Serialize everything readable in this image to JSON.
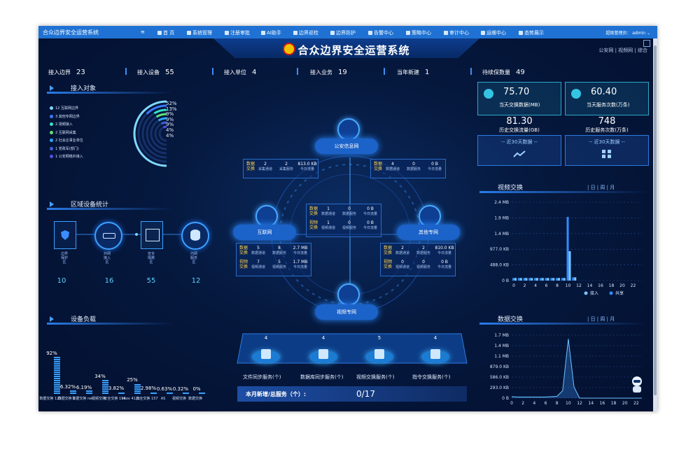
{
  "nav": {
    "brand": "合众边界安全运营系统",
    "items": [
      "首 页",
      "系统管理",
      "注册审批",
      "AI助手",
      "边界巡检",
      "边界防护",
      "告警中心",
      "策略中心",
      "审计中心",
      "运维中心",
      "态势展示"
    ],
    "user": "超级管理员： admin"
  },
  "dash": {
    "title": "合众边界安全运营系统",
    "topright": "公安网 | 视频网 | 综合",
    "stats": [
      {
        "label": "接入边界",
        "value": "23"
      },
      {
        "label": "接入设备",
        "value": "55"
      },
      {
        "label": "接入单位",
        "value": "4"
      },
      {
        "label": "接入业务",
        "value": "19"
      },
      {
        "label": "当年新建",
        "value": "1"
      },
      {
        "label": "待续保数量",
        "value": "49"
      }
    ]
  },
  "access": {
    "heading": "接入对象",
    "legend": [
      {
        "text": "12 互联网边界",
        "color": "#7fd8ff"
      },
      {
        "text": "3 其他专网边界",
        "color": "#3b78ff"
      },
      {
        "text": "2 视频接入",
        "color": "#36e0c8"
      },
      {
        "text": "2 互联网采集",
        "color": "#5fe07a"
      },
      {
        "text": "2 社会企事业单位",
        "color": "#2aa6ff"
      },
      {
        "text": "1 党政军(部门)",
        "color": "#3b62d8"
      },
      {
        "text": "1 公安网络外接入",
        "color": "#5a4fe0"
      }
    ],
    "percents": [
      "52%",
      "13%",
      "9%",
      "9%",
      "9%",
      "4%",
      "4%"
    ],
    "chart_data": {
      "type": "radial-bar",
      "categories": [
        "12 互联网边界",
        "3 其他专网边界",
        "2 视频接入",
        "2 互联网采集",
        "2 社会企事业单位",
        "1 党政军(部门)",
        "1 公安网络外接入"
      ],
      "values": [
        52,
        13,
        9,
        9,
        9,
        4,
        4
      ]
    }
  },
  "region": {
    "heading": "区域设备统计",
    "items": [
      {
        "label": "边界保护区",
        "value": "10"
      },
      {
        "label": "外网接入区",
        "value": "16"
      },
      {
        "label": "安全隔离区",
        "value": "55"
      },
      {
        "label": "内网服务区",
        "value": "12"
      }
    ]
  },
  "load": {
    "heading": "设备负载",
    "chart_data": {
      "type": "bar",
      "categories": [
        "数据交换",
        "数据交换\n123",
        "数据交换\n1",
        "视频交换\nnei",
        "视频交换",
        "安全交换\n156",
        "vaov\n4121",
        "安全交换\n157",
        "AS",
        "视频交换\n视频交换"
      ],
      "values": [
        92,
        6.32,
        6.19,
        34,
        3.82,
        25,
        2.98,
        0.63,
        0.32,
        0
      ],
      "labels": [
        "92%",
        "6.32%",
        "6.19%",
        "34%",
        "3.82%",
        "25%",
        "2.98%",
        "0.63%",
        "0.32%",
        "0%"
      ]
    },
    "xlabels": [
      "数据交换\n123",
      "数据交换\n1",
      "数据交换\nnei",
      "视频交换",
      "安全交换\n156",
      "vaov\n4121",
      "安全交换\n157",
      "AS",
      "视频交换",
      "数据交换"
    ]
  },
  "center": {
    "nodes": {
      "top": "公安信息网",
      "left": "互联网",
      "right": "其他专网",
      "bottom": "视频专网"
    },
    "cards": {
      "topleft": {
        "label": "数据交换",
        "cells": [
          {
            "n": "2",
            "d": "采集通道"
          },
          {
            "n": "2",
            "d": "采集服务"
          },
          {
            "n": "813.0 KB",
            "d": "今日流量"
          }
        ]
      },
      "topright": {
        "label": "数据交换",
        "cells": [
          {
            "n": "4",
            "d": "数据通道"
          },
          {
            "n": "0",
            "d": "数据服务"
          },
          {
            "n": "0 B",
            "d": "今日流量"
          }
        ]
      },
      "middle": [
        {
          "label": "数据交换",
          "cells": [
            {
              "n": "1",
              "d": "数据通道"
            },
            {
              "n": "0",
              "d": "数据服务"
            },
            {
              "n": "0 B",
              "d": "今日流量"
            }
          ]
        },
        {
          "label": "视频交换",
          "cells": [
            {
              "n": "1",
              "d": "视频通道"
            },
            {
              "n": "0",
              "d": "视频服务"
            },
            {
              "n": "0 B",
              "d": "今日流量"
            }
          ]
        }
      ],
      "left": [
        {
          "label": "数据交换",
          "cells": [
            {
              "n": "5",
              "d": "数据通道"
            },
            {
              "n": "8",
              "d": "数据服务"
            },
            {
              "n": "2.7 MB",
              "d": "今日流量"
            }
          ]
        },
        {
          "label": "视频交换",
          "cells": [
            {
              "n": "7",
              "d": "视频通道"
            },
            {
              "n": "5",
              "d": "视频服务"
            },
            {
              "n": "1.7 MB",
              "d": "今日流量"
            }
          ]
        }
      ],
      "right": [
        {
          "label": "数据交换",
          "cells": [
            {
              "n": "2",
              "d": "数据通道"
            },
            {
              "n": "2",
              "d": "数据服务"
            },
            {
              "n": "810.0 KB",
              "d": "今日流量"
            }
          ]
        },
        {
          "label": "视频交换",
          "cells": [
            {
              "n": "0",
              "d": "视频通道"
            },
            {
              "n": "0",
              "d": "视频服务"
            },
            {
              "n": "0 B",
              "d": "今日流量"
            }
          ]
        }
      ]
    },
    "services": [
      {
        "num": "4",
        "label": "文件同步服务(个)"
      },
      {
        "num": "4",
        "label": "数据库同步服务(个)"
      },
      {
        "num": "5",
        "label": "视频交换服务(个)"
      },
      {
        "num": "4",
        "label": "指令交换服务(个)"
      }
    ],
    "month_label": "本月新增/总服务（个）:",
    "month_value": "0/17"
  },
  "right": {
    "kpis": [
      {
        "value": "75.70",
        "label": "当天交换数据(MB)"
      },
      {
        "value": "60.40",
        "label": "当天服务次数(万条)"
      }
    ],
    "hist": [
      {
        "value": "81.30",
        "label": "历史交换流量(GB)"
      },
      {
        "value": "748",
        "label": "历史服务次数(万条)"
      }
    ],
    "buttons": [
      "-- 近30天数据 --",
      "-- 近30天数据 --"
    ],
    "video": {
      "heading": "视频交换",
      "tabs": "| 日 | 周 | 月",
      "yticks": [
        "2.4 MB",
        "1.9 MB",
        "1.4 MB",
        "977.0 KB",
        "488.0 KB",
        "0 B"
      ],
      "xticks": [
        "0",
        "2",
        "4",
        "6",
        "8",
        "10",
        "12",
        "14",
        "16",
        "18",
        "20",
        "22"
      ],
      "legend": [
        "接入",
        "共享"
      ],
      "chart_data": {
        "type": "bar",
        "x": [
          0,
          1,
          2,
          3,
          4,
          5,
          6,
          7,
          8,
          9,
          10,
          11,
          12,
          13,
          14,
          15,
          16,
          17,
          18,
          19,
          20,
          21,
          22,
          23
        ],
        "ylim": [
          0,
          2.4
        ],
        "series": [
          {
            "name": "接入",
            "values": [
              0.08,
              0.08,
              0.08,
              0.08,
              0.08,
              0.08,
              0.08,
              0.08,
              0.08,
              0.08,
              1.95,
              0.1,
              0,
              0,
              0,
              0,
              0,
              0,
              0,
              0,
              0,
              0,
              0,
              0
            ]
          },
          {
            "name": "共享",
            "values": [
              0.08,
              0.08,
              0.08,
              0.08,
              0.08,
              0.08,
              0.08,
              0.08,
              0.08,
              0.08,
              0.9,
              0.1,
              0,
              0,
              0,
              0,
              0,
              0,
              0,
              0,
              0,
              0,
              0,
              0
            ]
          }
        ]
      }
    },
    "data": {
      "heading": "数据交换",
      "tabs": "| 日 | 周 | 月",
      "yticks": [
        "1.7 MB",
        "1.4 MB",
        "1.1 MB",
        "879.0 KB",
        "586.0 KB",
        "293.0 KB",
        "0 B"
      ],
      "xticks": [
        "0",
        "2",
        "4",
        "6",
        "8",
        "10",
        "12",
        "14",
        "16",
        "18",
        "20",
        "22"
      ],
      "chart_data": {
        "type": "area",
        "x": [
          0,
          1,
          2,
          3,
          4,
          5,
          6,
          7,
          8,
          9,
          10,
          11,
          12,
          13,
          14,
          15,
          16,
          17,
          18,
          19,
          20,
          21,
          22,
          23
        ],
        "ylim": [
          0,
          1.7
        ],
        "series": [
          {
            "name": "接入",
            "values": [
              0.04,
              0.03,
              0.03,
              0.03,
              0.03,
              0.03,
              0.03,
              0.04,
              0.05,
              0.2,
              1.6,
              0.3,
              0,
              0,
              0,
              0,
              0,
              0,
              0,
              0,
              0,
              0,
              0,
              0
            ]
          }
        ]
      }
    }
  }
}
